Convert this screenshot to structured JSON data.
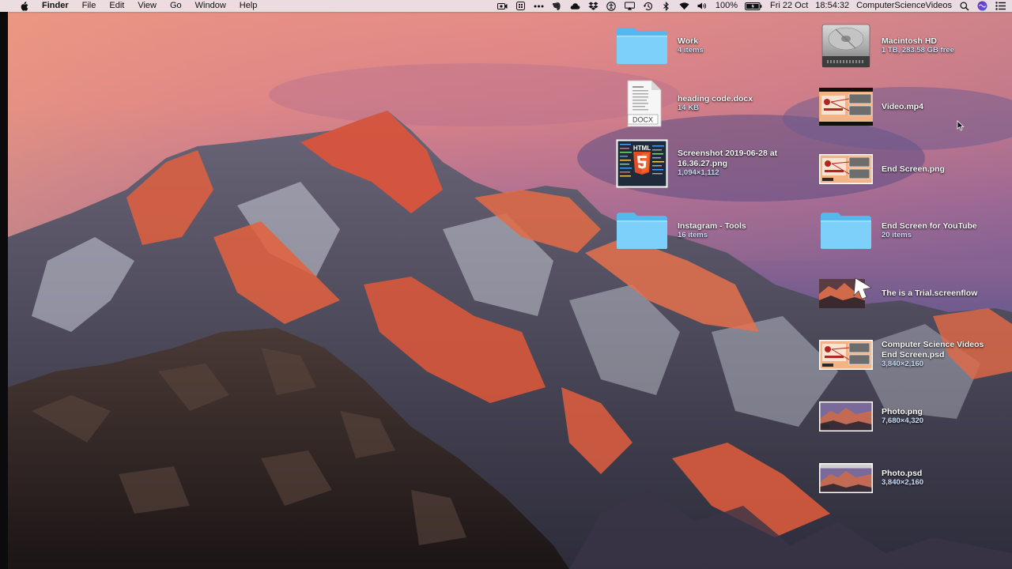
{
  "menubar": {
    "app_name": "Finder",
    "menus": [
      "File",
      "Edit",
      "View",
      "Go",
      "Window",
      "Help"
    ],
    "status_icons": [
      "screen-record-icon",
      "qr-icon",
      "dots-icon",
      "evernote-icon",
      "cloud-icon",
      "dropbox-icon",
      "accessibility-icon",
      "airplay-icon",
      "time-machine-icon",
      "bluetooth-icon",
      "wifi-icon",
      "volume-icon"
    ],
    "battery": "100%",
    "date": "Fri 22 Oct",
    "time": "18:54:32",
    "user": "ComputerScienceVideos"
  },
  "desktop": {
    "items": [
      {
        "name": "Work",
        "info": "4 items",
        "kind": "folder-icon"
      },
      {
        "name": "heading code.docx",
        "info": "14 KB",
        "kind": "docx-icon"
      },
      {
        "name": "Screenshot 2019-06-28 at 16.36.27.png",
        "info": "1,094×1,112",
        "kind": "image-thumbnail"
      },
      {
        "name": "Instagram - Tools",
        "info": "16 items",
        "kind": "folder-icon"
      },
      {
        "name": "Macintosh HD",
        "info": "1 TB, 283.58 GB free",
        "kind": "hard-drive-icon"
      },
      {
        "name": "Video.mp4",
        "info": "",
        "kind": "video-thumbnail"
      },
      {
        "name": "End Screen.png",
        "info": "",
        "kind": "image-thumbnail"
      },
      {
        "name": "End Screen for YouTube",
        "info": "20 items",
        "kind": "folder-icon"
      },
      {
        "name": "The is a Trial.screenflow",
        "info": "",
        "kind": "screenflow-icon"
      },
      {
        "name": "Computer Science Videos End Screen.psd",
        "info": "3,840×2,160",
        "kind": "image-thumbnail"
      },
      {
        "name": "Photo.png",
        "info": "7,680×4,320",
        "kind": "image-thumbnail"
      },
      {
        "name": "Photo.psd",
        "info": "3,840×2,160",
        "kind": "image-thumbnail"
      }
    ],
    "docx_badge": "DOCX",
    "html5_badge": "HTML"
  }
}
